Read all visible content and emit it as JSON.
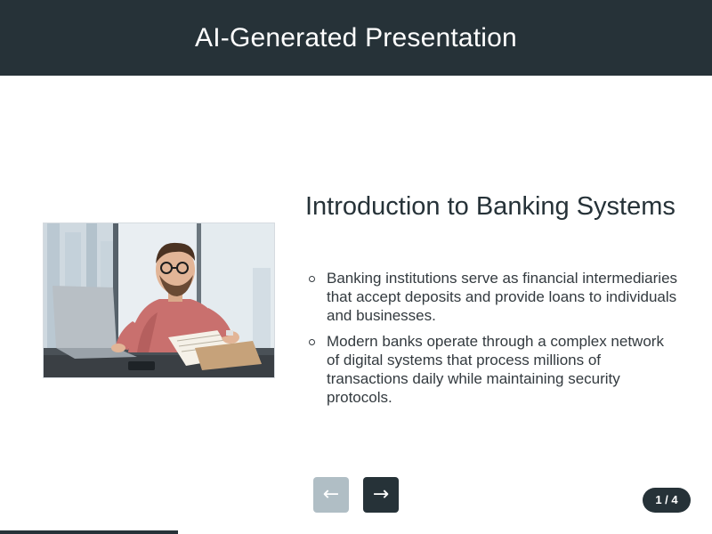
{
  "header": {
    "title": "AI-Generated Presentation"
  },
  "slide": {
    "image_description_icon": "photo-man-at-laptop",
    "title": "Introduction to Banking Systems",
    "bullets": [
      "Banking institutions serve as financial intermediaries that accept deposits and provide loans to individuals and businesses.",
      "Modern banks operate through a complex network of digital systems that process millions of transactions daily while maintaining security protocols."
    ]
  },
  "navigation": {
    "prev_label": "←",
    "next_label": "→",
    "prev_enabled": false,
    "next_enabled": true,
    "counter": "1 / 4",
    "current_page": 1,
    "total_pages": 4
  },
  "progress": {
    "fraction": 0.25
  },
  "colors": {
    "header_bg": "#263238",
    "button_active": "#263238",
    "button_disabled": "#b0bec5",
    "text": "#263238"
  }
}
